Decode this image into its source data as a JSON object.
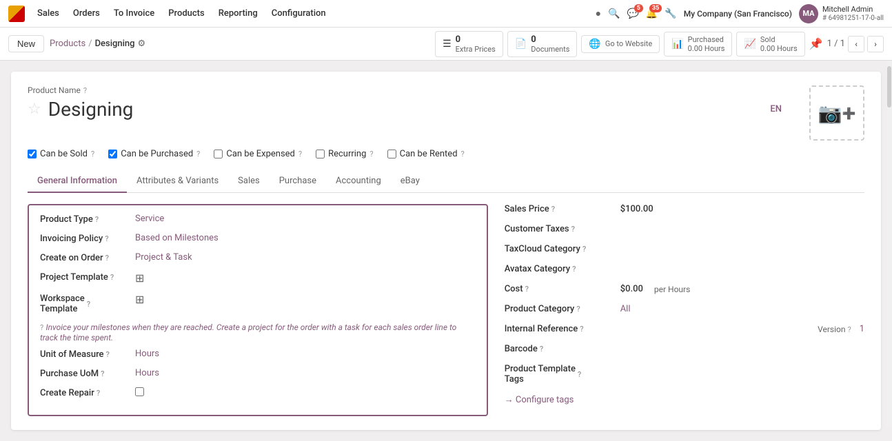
{
  "nav": {
    "logo_alt": "Odoo",
    "links": [
      "Sales",
      "Orders",
      "To Invoice",
      "Products",
      "Reporting",
      "Configuration"
    ],
    "icons": [
      "●",
      "🔔",
      "💬",
      "📢",
      "🔧"
    ],
    "notification_counts": [
      "",
      "",
      "5",
      "35",
      ""
    ],
    "company": "My Company (San Francisco)",
    "user_name": "Mitchell Admin",
    "user_sub": "# 64981251-17-0-all",
    "user_initials": "MA"
  },
  "action_bar": {
    "new_label": "New",
    "breadcrumb_parent": "Products",
    "breadcrumb_current": "Designing",
    "extra_prices_label": "Extra Prices",
    "extra_prices_count": "0",
    "documents_label": "Documents",
    "documents_count": "0",
    "go_to_website_label": "Go to Website",
    "purchased_label": "Purchased",
    "purchased_hours": "0.00 Hours",
    "sold_label": "Sold",
    "sold_hours": "0.00 Hours",
    "pager": "1 / 1"
  },
  "product": {
    "name_label": "Product Name",
    "name_value": "Designing",
    "lang": "EN",
    "star_empty": "☆",
    "photo_icon": "📷"
  },
  "checkboxes": [
    {
      "label": "Can be Sold",
      "checked": true
    },
    {
      "label": "Can be Purchased",
      "checked": true
    },
    {
      "label": "Can be Expensed",
      "checked": false
    },
    {
      "label": "Recurring",
      "checked": false
    },
    {
      "label": "Can be Rented",
      "checked": false
    }
  ],
  "tabs": [
    {
      "label": "General Information",
      "active": true
    },
    {
      "label": "Attributes & Variants",
      "active": false
    },
    {
      "label": "Sales",
      "active": false
    },
    {
      "label": "Purchase",
      "active": false
    },
    {
      "label": "Accounting",
      "active": false
    },
    {
      "label": "eBay",
      "active": false
    }
  ],
  "left_fields": [
    {
      "label": "Product Type",
      "help": true,
      "value": "Service",
      "type": "link"
    },
    {
      "label": "Invoicing Policy",
      "help": true,
      "value": "Based on Milestones",
      "type": "link"
    },
    {
      "label": "Create on Order",
      "help": true,
      "value": "Project & Task",
      "type": "link"
    },
    {
      "label": "Project Template",
      "help": true,
      "value": "",
      "type": "icon",
      "icon": "⊞"
    },
    {
      "label": "Workspace Template",
      "help": true,
      "value": "",
      "type": "icon",
      "icon": "⊞"
    }
  ],
  "info_text": "Invoice your milestones when they are reached. Create a project for the order with a task for each sales order line to track the time spent.",
  "bottom_left_fields": [
    {
      "label": "Unit of Measure",
      "help": true,
      "value": "Hours",
      "type": "link"
    },
    {
      "label": "Purchase UoM",
      "help": true,
      "value": "Hours",
      "type": "link"
    },
    {
      "label": "Create Repair",
      "help": true,
      "value": "",
      "type": "checkbox"
    }
  ],
  "right_fields": [
    {
      "label": "Sales Price",
      "help": true,
      "value": "$100.00",
      "type": "price"
    },
    {
      "label": "Customer Taxes",
      "help": true,
      "value": "",
      "type": "empty"
    },
    {
      "label": "TaxCloud Category",
      "help": true,
      "value": "",
      "type": "empty"
    },
    {
      "label": "Avatax Category",
      "help": true,
      "value": "",
      "type": "empty"
    },
    {
      "label": "Cost",
      "help": true,
      "value": "$0.00",
      "extra": "per Hours",
      "type": "cost"
    },
    {
      "label": "Product Category",
      "help": true,
      "value": "All",
      "type": "link"
    },
    {
      "label": "Internal Reference",
      "help": true,
      "value": "",
      "type": "empty",
      "right_label": "Version",
      "right_help": true,
      "right_value": "1"
    },
    {
      "label": "Barcode",
      "help": true,
      "value": "",
      "type": "empty"
    },
    {
      "label": "Product Template Tags",
      "help": true,
      "value": "",
      "type": "empty"
    }
  ],
  "configure_tags_label": "→ Configure tags"
}
